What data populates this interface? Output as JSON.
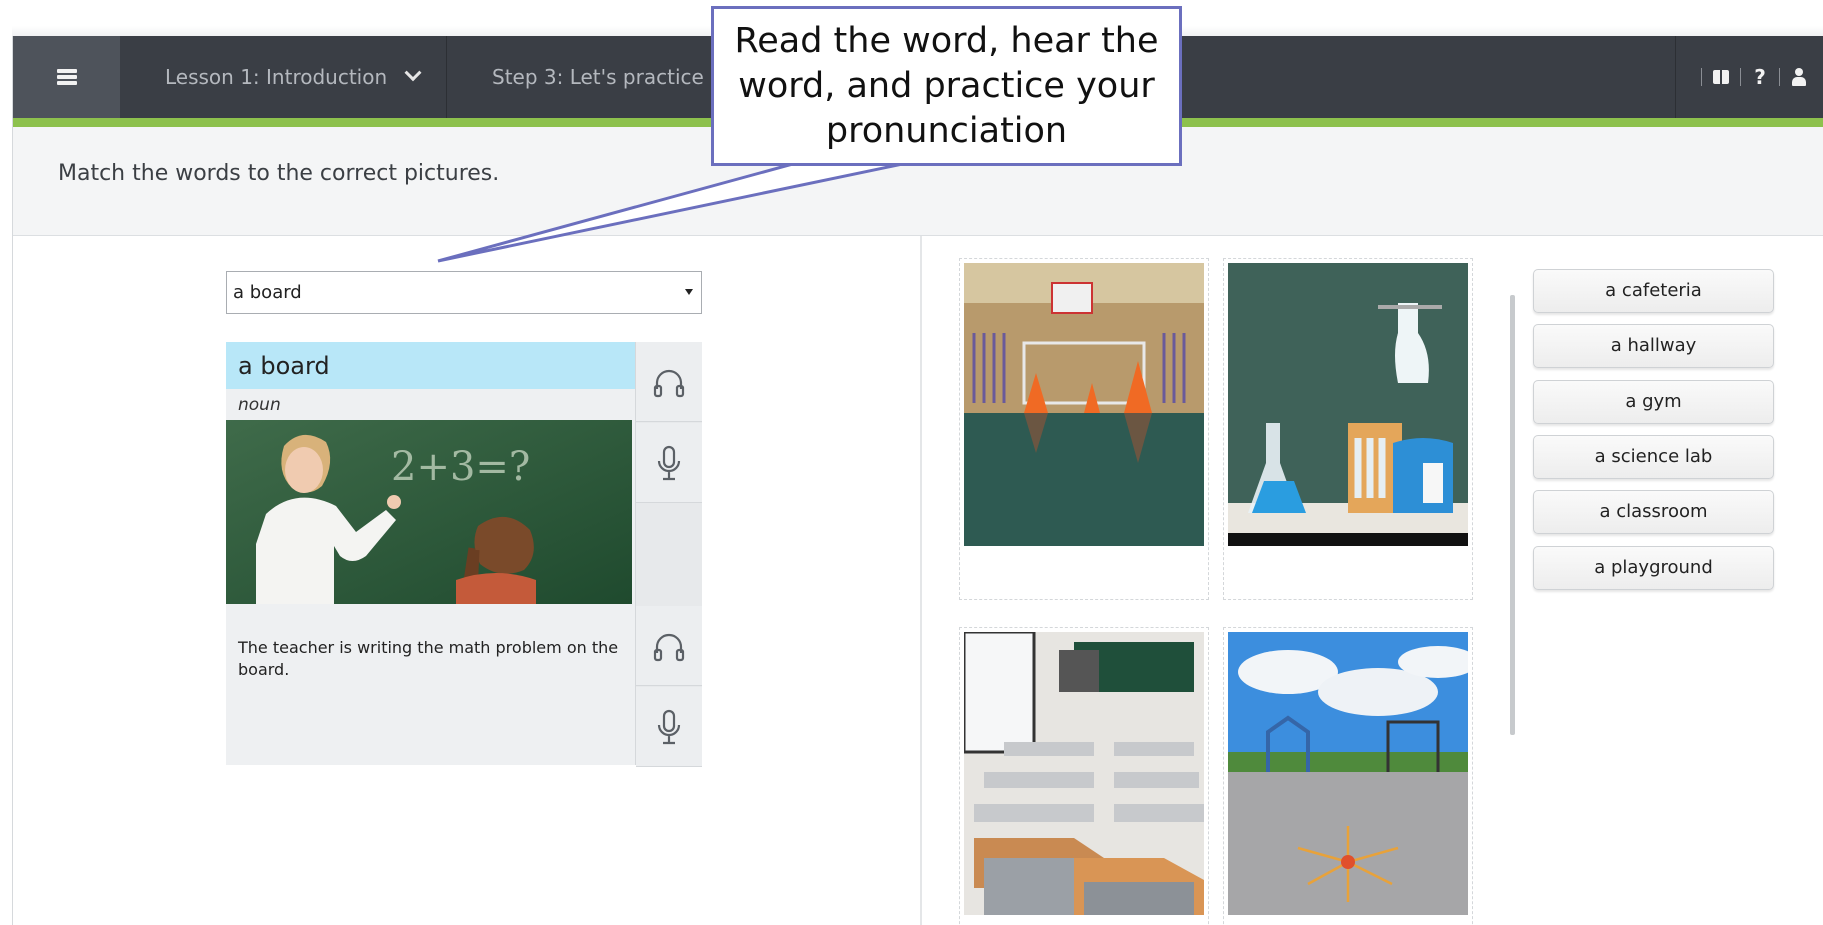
{
  "nav": {
    "lesson_label": "Lesson 1: Introduction",
    "step_label": "Step 3: Let's practice",
    "tools": [
      "book-icon",
      "help-icon",
      "user-icon"
    ],
    "help_glyph": "?"
  },
  "instruction": "Match the words to the correct pictures.",
  "word_select": {
    "value": "a board"
  },
  "word_card": {
    "word": "a board",
    "part_of_speech": "noun",
    "example": "The teacher is writing the math problem on the board.",
    "chalk_text": "2+3=?"
  },
  "pictures": [
    "gym-photo",
    "science-lab-photo",
    "classroom-photo",
    "playground-photo"
  ],
  "word_bank": [
    "a cafeteria",
    "a hallway",
    "a gym",
    "a science lab",
    "a classroom",
    "a playground"
  ],
  "callout": {
    "line1": "Read the word, hear the",
    "line2": "word, and practice your",
    "line3": "pronunciation"
  },
  "colors": {
    "topbar": "#3a3e45",
    "accent": "#8dc14d",
    "word_highlight": "#b8e7f8",
    "callout_border": "#6b6fbe"
  }
}
